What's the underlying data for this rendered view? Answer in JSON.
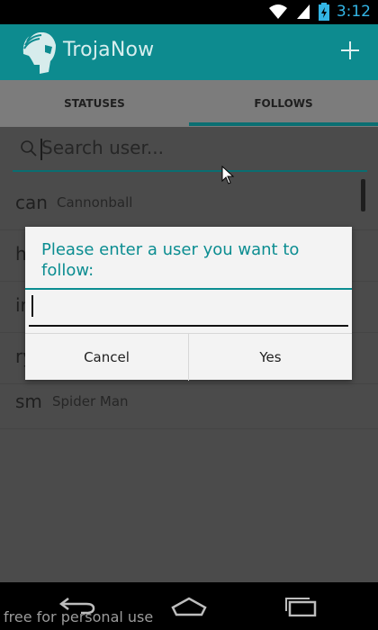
{
  "status_bar": {
    "time": "3:12"
  },
  "app": {
    "title": "TrojaNow"
  },
  "tabs": [
    {
      "label": "STATUSES",
      "active": false
    },
    {
      "label": "FOLLOWS",
      "active": true
    }
  ],
  "search": {
    "placeholder": "Search user..."
  },
  "users": [
    {
      "handle": "can",
      "name": "Cannonball"
    },
    {
      "handle": "h",
      "name": ""
    },
    {
      "handle": "ir",
      "name": ""
    },
    {
      "handle": "ry",
      "name": ""
    },
    {
      "handle": "sm",
      "name": "Spider Man"
    }
  ],
  "dialog": {
    "title": "Please enter a user you want to follow:",
    "input_value": "",
    "cancel_label": "Cancel",
    "confirm_label": "Yes"
  },
  "watermark": "free for personal use",
  "colors": {
    "accent": "#0b8d91",
    "app_bar": "#0d8b8f",
    "clock": "#33b5e5"
  },
  "icons": [
    "wifi-icon",
    "signal-icon",
    "battery-charging-icon",
    "add-icon",
    "search-icon",
    "back-icon",
    "home-icon",
    "recent-apps-icon"
  ]
}
